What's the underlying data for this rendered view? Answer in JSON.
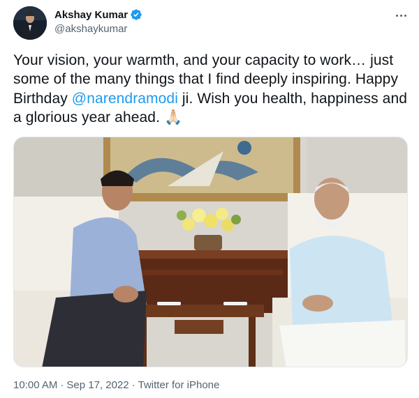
{
  "author": {
    "display_name": "Akshay Kumar",
    "handle": "@akshaykumar",
    "verified_icon": "verified-badge-icon"
  },
  "tweet": {
    "text_before": "Your vision, your warmth, and your capacity to work… just some of the many things that I find deeply inspiring. Happy Birthday ",
    "mention": "@narendramodi",
    "text_after": " ji. Wish you health, happiness and a glorious year ahead. ",
    "emoji": "🙏🏻"
  },
  "media": {
    "alt_icon": "photo-two-men-seated-in-armchairs"
  },
  "meta": {
    "time": "10:00 AM",
    "date": "Sep 17, 2022",
    "separator": "·",
    "source": "Twitter for iPhone"
  },
  "colors": {
    "link": "#1d9bf0",
    "text": "#0f1419",
    "secondary": "#536471"
  }
}
